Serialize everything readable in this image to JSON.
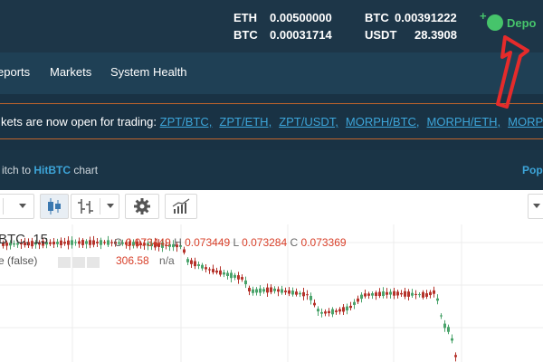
{
  "balances": [
    {
      "currency": "ETH",
      "amount": "0.00500000"
    },
    {
      "currency": "BTC",
      "amount": "0.00391222"
    },
    {
      "currency": "BTC",
      "amount": "0.00031714"
    },
    {
      "currency": "USDT",
      "amount": "28.3908"
    }
  ],
  "deposit_label": "Depo",
  "nav": [
    "eports",
    "Markets",
    "System Health"
  ],
  "banner": {
    "prefix": "kets are now open for trading:",
    "markets": [
      "ZPT/BTC,",
      "ZPT/ETH,",
      "ZPT/USDT,",
      "MORPH/BTC,",
      "MORPH/ETH,",
      "MORPH/U"
    ]
  },
  "switch": {
    "prefix": "itch to ",
    "hitbtc": "HitBTC",
    "suffix": " chart",
    "popup": "Pop"
  },
  "chart": {
    "symbol": "BTC, 15",
    "o_label": "O",
    "o_value": "0.073449",
    "h_label": "H",
    "h_value": "0.073449",
    "l_label": "L",
    "l_value": "0.073284",
    "c_label": "C",
    "c_value": "0.073369",
    "indicator": "e (false)",
    "indicator_value": "306.58",
    "indicator_na": "n/a"
  },
  "colors": {
    "up": "#4aa36b",
    "down": "#b5332b",
    "accent": "#3da5d9",
    "arrow": "#e52b2b"
  }
}
